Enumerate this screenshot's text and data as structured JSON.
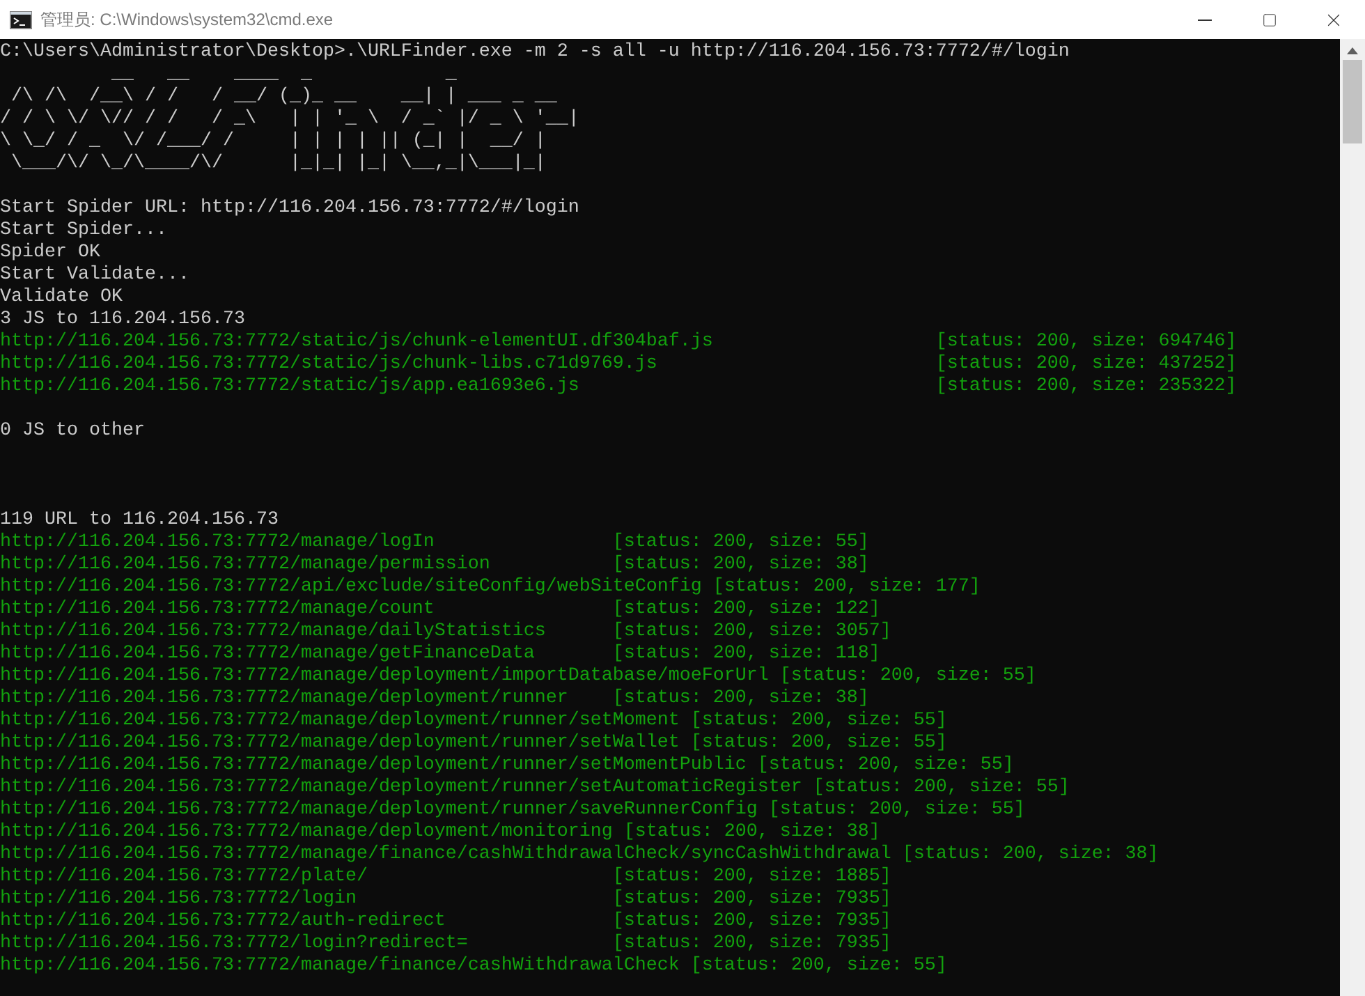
{
  "window": {
    "title": "管理员: C:\\Windows\\system32\\cmd.exe"
  },
  "console": {
    "command": "C:\\Users\\Administrator\\Desktop>.\\URLFinder.exe -m 2 -s all -u http://116.204.156.73:7772/#/login",
    "banner": [
      "          __   __    ____  _            _",
      " /\\ /\\  /__\\ / /   / __/ (_)_ __    __| | ___ _ __",
      "/ / \\ \\/ \\// / /   / _\\   | | '_ \\  / _` |/ _ \\ '__|",
      "\\ \\_/ / _  \\/ /___/ /     | | | | || (_| |  __/ |",
      " \\___/\\/ \\_/\\____/\\/      |_|_| |_| \\__,_|\\___|_|"
    ],
    "log": [
      "Start Spider URL: http://116.204.156.73:7772/#/login",
      "Start Spider...",
      "Spider OK",
      "Start Validate...",
      "Validate OK"
    ],
    "groups": [
      {
        "heading": "3 JS to 116.204.156.73",
        "urls": [
          {
            "url": "http://116.204.156.73:7772/static/js/chunk-elementUI.df304baf.js",
            "status": "[status: 200, size: 694746]"
          },
          {
            "url": "http://116.204.156.73:7772/static/js/chunk-libs.c71d9769.js",
            "status": "[status: 200, size: 437252]"
          },
          {
            "url": "http://116.204.156.73:7772/static/js/app.ea1693e6.js",
            "status": "[status: 200, size: 235322]"
          }
        ]
      },
      {
        "heading": "0 JS to other"
      },
      {
        "heading": "119 URL to 116.204.156.73",
        "urls": [
          {
            "url": "http://116.204.156.73:7772/manage/logIn",
            "status": "[status: 200, size: 55]"
          },
          {
            "url": "http://116.204.156.73:7772/manage/permission",
            "status": "[status: 200, size: 38]"
          },
          {
            "url": "http://116.204.156.73:7772/api/exclude/siteConfig/webSiteConfig",
            "status": "[status: 200, size: 177]"
          },
          {
            "url": "http://116.204.156.73:7772/manage/count",
            "status": "[status: 200, size: 122]"
          },
          {
            "url": "http://116.204.156.73:7772/manage/dailyStatistics",
            "status": "[status: 200, size: 3057]"
          },
          {
            "url": "http://116.204.156.73:7772/manage/getFinanceData",
            "status": "[status: 200, size: 118]"
          },
          {
            "url": "http://116.204.156.73:7772/manage/deployment/importDatabase/moeForUrl",
            "status": "[status: 200, size: 55]"
          },
          {
            "url": "http://116.204.156.73:7772/manage/deployment/runner",
            "status": "[status: 200, size: 38]"
          },
          {
            "url": "http://116.204.156.73:7772/manage/deployment/runner/setMoment",
            "status": "[status: 200, size: 55]"
          },
          {
            "url": "http://116.204.156.73:7772/manage/deployment/runner/setWallet",
            "status": "[status: 200, size: 55]"
          },
          {
            "url": "http://116.204.156.73:7772/manage/deployment/runner/setMomentPublic",
            "status": "[status: 200, size: 55]"
          },
          {
            "url": "http://116.204.156.73:7772/manage/deployment/runner/setAutomaticRegister",
            "status": "[status: 200, size: 55]"
          },
          {
            "url": "http://116.204.156.73:7772/manage/deployment/runner/saveRunnerConfig",
            "status": "[status: 200, size: 55]"
          },
          {
            "url": "http://116.204.156.73:7772/manage/deployment/monitoring",
            "status": "[status: 200, size: 38]"
          },
          {
            "url": "http://116.204.156.73:7772/manage/finance/cashWithdrawalCheck/syncCashWithdrawal",
            "status": "[status: 200, size: 38]"
          },
          {
            "url": "http://116.204.156.73:7772/plate/",
            "status": "[status: 200, size: 1885]"
          },
          {
            "url": "http://116.204.156.73:7772/login",
            "status": "[status: 200, size: 7935]"
          },
          {
            "url": "http://116.204.156.73:7772/auth-redirect",
            "status": "[status: 200, size: 7935]"
          },
          {
            "url": "http://116.204.156.73:7772/login?redirect=",
            "status": "[status: 200, size: 7935]"
          },
          {
            "url": "http://116.204.156.73:7772/manage/finance/cashWithdrawalCheck",
            "status": "[status: 200, size: 55]"
          }
        ]
      }
    ]
  }
}
